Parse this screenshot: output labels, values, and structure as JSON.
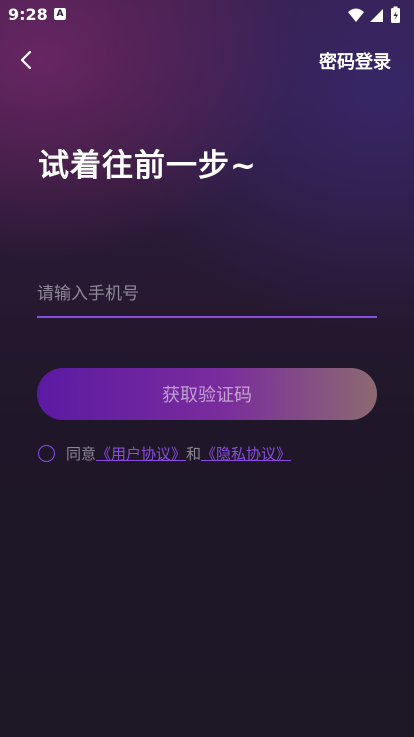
{
  "status_bar": {
    "time": "9:28",
    "notification_icon_letter": "A",
    "icons": [
      "wifi-icon",
      "signal-icon",
      "battery-icon"
    ]
  },
  "header": {
    "back_icon": "chevron-left-icon",
    "password_login": "密码登录"
  },
  "title": "试着往前一步~",
  "phone_input": {
    "placeholder": "请输入手机号",
    "value": ""
  },
  "get_code_button": "获取验证码",
  "agreement": {
    "checked": false,
    "prefix": "同意",
    "user_agreement": "《用户协议》",
    "conjunction": "和",
    "privacy_policy": "《隐私协议》"
  },
  "colors": {
    "accent": "#8a4de0",
    "button_start": "#5c1aa3",
    "button_end": "#8c6a70",
    "background": "#1d1726"
  }
}
